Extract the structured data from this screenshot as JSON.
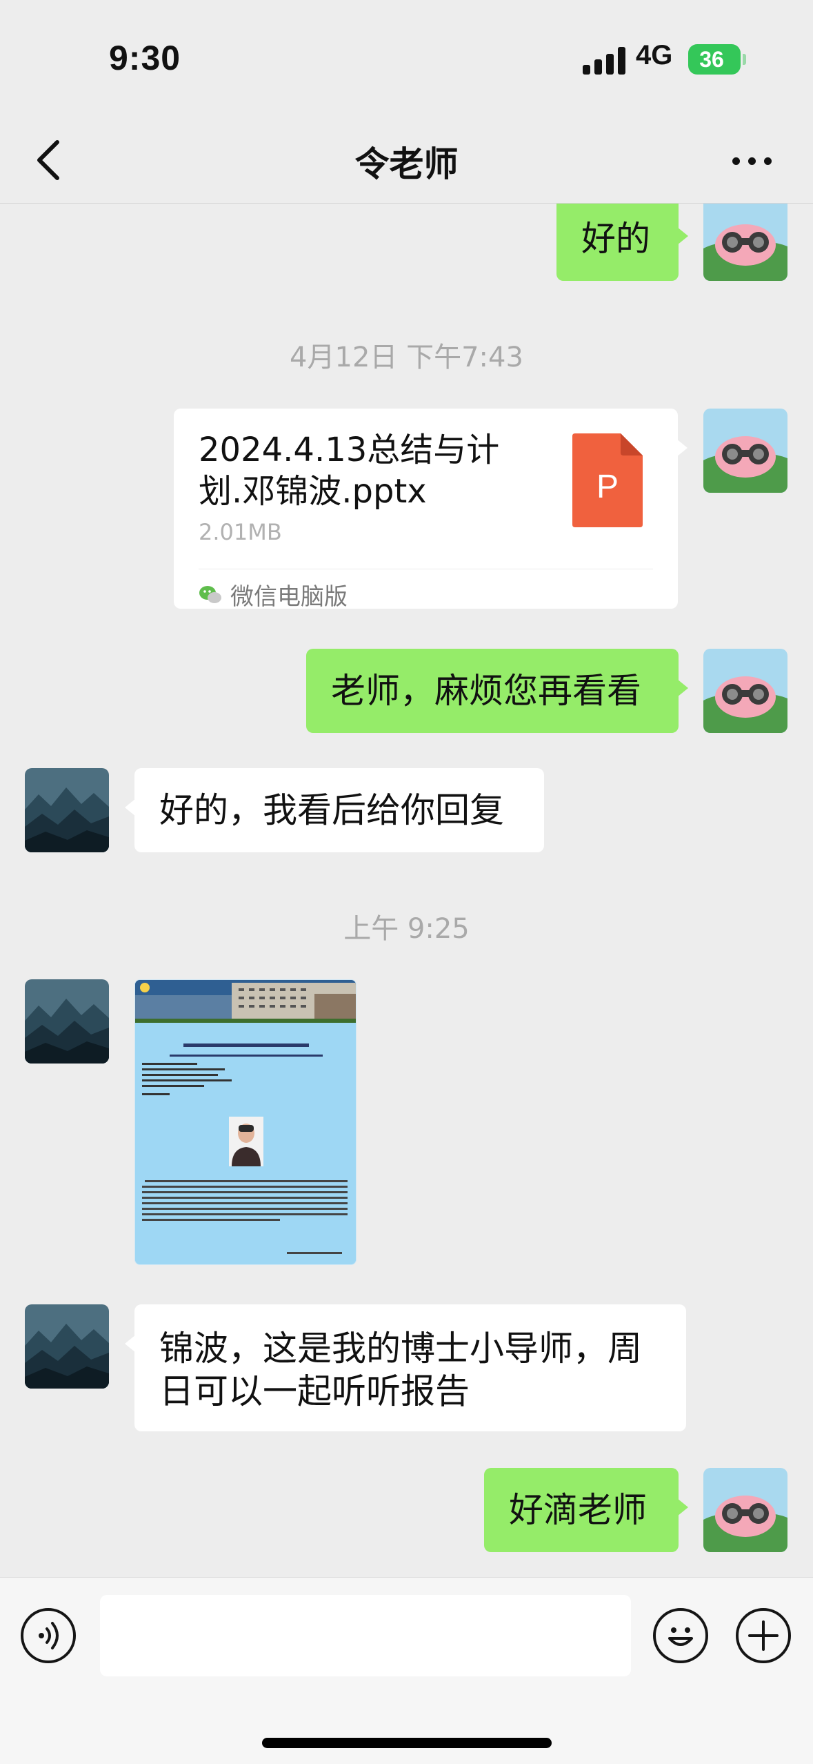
{
  "status_bar": {
    "time": "9:30",
    "network": "4G",
    "battery": "36"
  },
  "nav": {
    "title": "令老师"
  },
  "messages": {
    "m1": "好的",
    "ts1": "4月12日 下午7:43",
    "file": {
      "name": "2024.4.13总结与计划.邓锦波.pptx",
      "size": "2.01MB",
      "source": "微信电脑版",
      "icon_letter": "P"
    },
    "m2": "老师，麻烦您再看看",
    "m3": "好的，我看后给你回复",
    "ts2": "上午 9:25",
    "m4": "锦波，这是我的博士小导师，周日可以一起听听报告",
    "m5": "好滴老师"
  },
  "poster": {
    "header": "兰州大学生命科学学院",
    "title": "“听百十华诞，创生命之新”学术报告"
  },
  "colors": {
    "outgoing_bubble": "#95ec69",
    "incoming_bubble": "#ffffff",
    "background": "#ededed",
    "ppt_orange": "#f0613e"
  }
}
